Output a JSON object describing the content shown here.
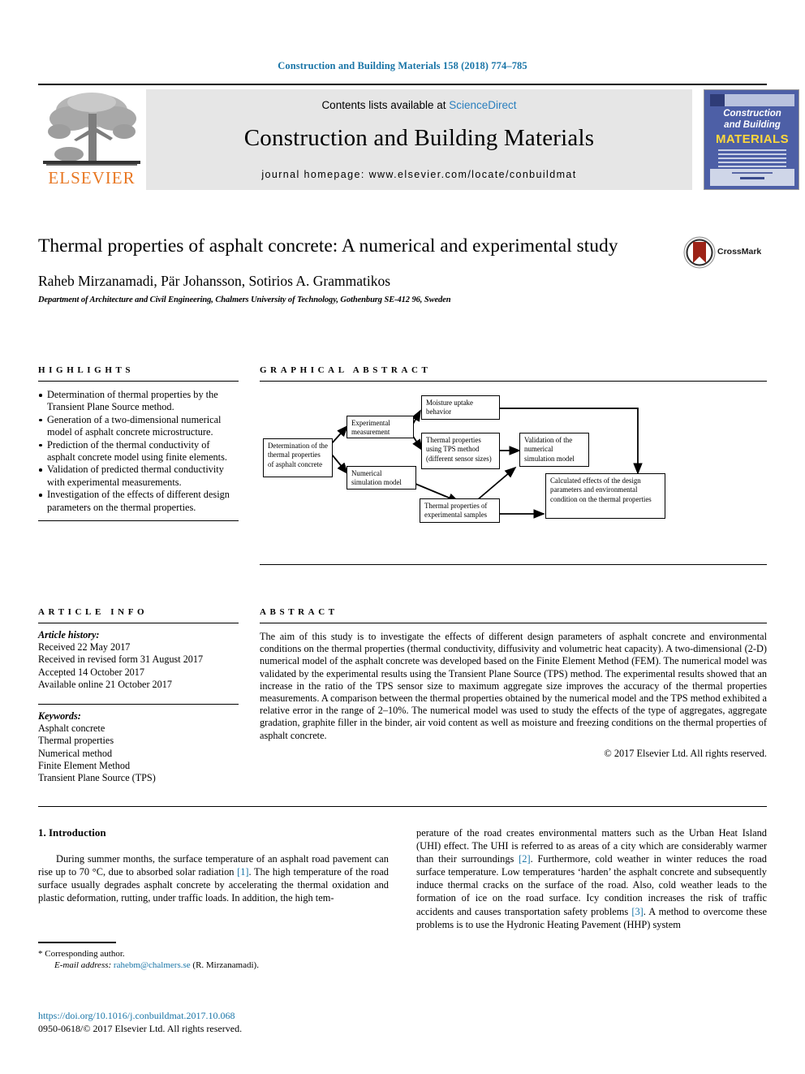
{
  "running_head": "Construction and Building Materials 158 (2018) 774–785",
  "masthead": {
    "contents_prefix": "Contents lists available at ",
    "sciencedirect": "ScienceDirect",
    "journal_title": "Construction and Building Materials",
    "homepage": "journal homepage: www.elsevier.com/locate/conbuildmat",
    "publisher_name": "ELSEVIER",
    "cover": {
      "line1": "Construction",
      "line2": "and Building",
      "line3": "MATERIALS"
    }
  },
  "article": {
    "title": "Thermal properties of asphalt concrete: A numerical and experimental study",
    "authors": "Raheb Mirzanamadi, Pär Johansson, Sotirios A. Grammatikos",
    "author_marker": "*",
    "affiliation": "Department of Architecture and Civil Engineering, Chalmers University of Technology, Gothenburg SE-412 96, Sweden",
    "crossmark_label": "CrossMark"
  },
  "highlights": {
    "heading": "Highlights",
    "items": [
      "Determination of thermal properties by the Transient Plane Source method.",
      "Generation of a two-dimensional numerical model of asphalt concrete microstructure.",
      "Prediction of the thermal conductivity of asphalt concrete model using finite elements.",
      "Validation of predicted thermal conductivity with experimental measurements.",
      "Investigation of the effects of different design parameters on the thermal properties."
    ]
  },
  "graphical_abstract": {
    "heading": "Graphical abstract",
    "boxes": [
      {
        "id": "determination",
        "text": "Determination of the thermal properties of asphalt concrete"
      },
      {
        "id": "experimental",
        "text": "Experimental measurement"
      },
      {
        "id": "numerical-model",
        "text": "Numerical simulation model"
      },
      {
        "id": "moisture",
        "text": "Moisture uptake behavior"
      },
      {
        "id": "tps-properties",
        "text": "Thermal properties using TPS method (different sensor sizes)"
      },
      {
        "id": "exp-properties",
        "text": "Thermal properties of experimental samples"
      },
      {
        "id": "validation",
        "text": "Validation of the numerical simulation model"
      },
      {
        "id": "calculated",
        "text": "Calculated effects of the design parameters and environmental condition on the thermal properties"
      }
    ]
  },
  "article_info": {
    "heading": "Article info",
    "history_label": "Article history:",
    "history": [
      "Received 22 May 2017",
      "Received in revised form 31 August 2017",
      "Accepted 14 October 2017",
      "Available online 21 October 2017"
    ],
    "keywords_label": "Keywords:",
    "keywords": [
      "Asphalt concrete",
      "Thermal properties",
      "Numerical method",
      "Finite Element Method",
      "Transient Plane Source (TPS)"
    ]
  },
  "abstract": {
    "heading": "Abstract",
    "text": "The aim of this study is to investigate the effects of different design parameters of asphalt concrete and environmental conditions on the thermal properties (thermal conductivity, diffusivity and volumetric heat capacity). A two-dimensional (2-D) numerical model of the asphalt concrete was developed based on the Finite Element Method (FEM). The numerical model was validated by the experimental results using the Transient Plane Source (TPS) method. The experimental results showed that an increase in the ratio of the TPS sensor size to maximum aggregate size improves the accuracy of the thermal properties measurements. A comparison between the thermal properties obtained by the numerical model and the TPS method exhibited a relative error in the range of 2–10%. The numerical model was used to study the effects of the type of aggregates, aggregate gradation, graphite filler in the binder, air void content as well as moisture and freezing conditions on the thermal properties of asphalt concrete.",
    "copyright": "© 2017 Elsevier Ltd. All rights reserved."
  },
  "introduction": {
    "section_title": "1. Introduction",
    "col1_part1": "During summer months, the surface temperature of an asphalt road pavement can rise up to 70 °C, due to absorbed solar radiation ",
    "ref1": "[1]",
    "col1_part2": ". The high temperature of the road surface usually degrades asphalt concrete by accelerating the thermal oxidation and plastic deformation, rutting, under traffic loads. In addition, the high tem-",
    "col2_part1": "perature of the road creates environmental matters such as the Urban Heat Island (UHI) effect. The UHI is referred to as areas of a city which are considerably warmer than their surroundings ",
    "ref2": "[2]",
    "col2_part2": ". Furthermore, cold weather in winter reduces the road surface temperature. Low temperatures ‘harden’ the asphalt concrete and subsequently induce thermal cracks on the surface of the road. Also, cold weather leads to the formation of ice on the road surface. Icy condition increases the risk of traffic accidents and causes transportation safety problems ",
    "ref3": "[3]",
    "col2_part3": ". A method to overcome these problems is to use the Hydronic Heating Pavement (HHP) system"
  },
  "footer": {
    "corresponding_marker": "*",
    "corresponding_text": "Corresponding author.",
    "email_label": "E-mail address:",
    "email": "rahebm@chalmers.se",
    "email_owner": "(R. Mirzanamadi).",
    "doi": "https://doi.org/10.1016/j.conbuildmat.2017.10.068",
    "issn_line": "0950-0618/© 2017 Elsevier Ltd. All rights reserved."
  },
  "colors": {
    "link_blue": "#1a75a7",
    "sciencedirect_blue": "#2a7fbe",
    "elsevier_orange": "#E87722",
    "cover_blue": "#4d5fa6",
    "crossmark_red": "#9d2418"
  }
}
